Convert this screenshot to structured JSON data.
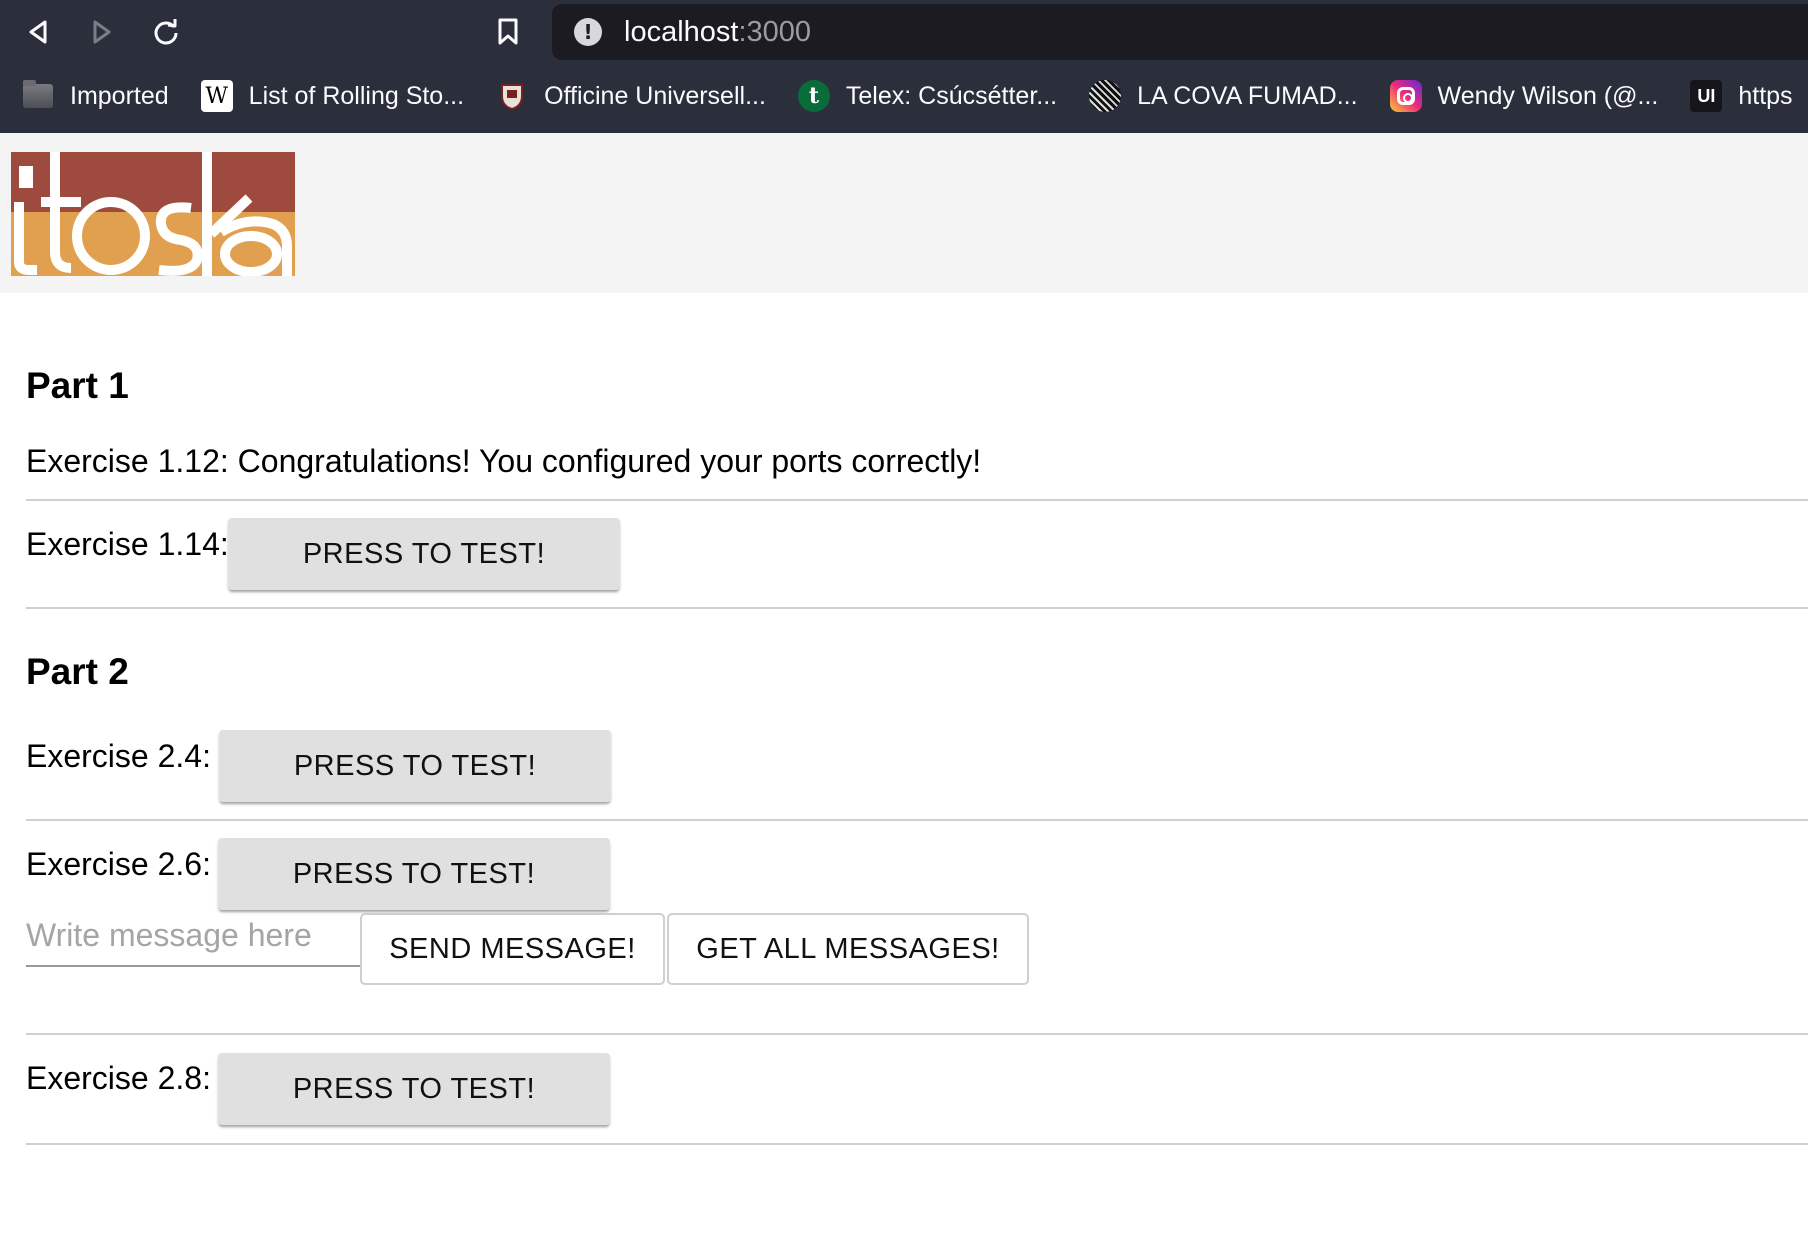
{
  "browser": {
    "url_host": "localhost",
    "url_port": ":3000",
    "bookmarks": [
      {
        "label": "Imported",
        "icon": "folder-icon"
      },
      {
        "label": "List of Rolling Sto...",
        "icon": "wikipedia-icon"
      },
      {
        "label": "Officine Universell...",
        "icon": "shield-crest-icon"
      },
      {
        "label": "Telex: Csúcsétter...",
        "icon": "telex-icon"
      },
      {
        "label": "LA COVA FUMAD...",
        "icon": "cova-icon"
      },
      {
        "label": "Wendy Wilson (@...",
        "icon": "instagram-icon"
      },
      {
        "label": "https",
        "icon": "ui-icon"
      }
    ],
    "ui_icon_text": "UI",
    "wiki_icon_text": "W",
    "telex_icon_text": "t"
  },
  "logo": {
    "text": "itoska",
    "colors": {
      "top": "#9e4a3e",
      "bottom": "#e0a050"
    }
  },
  "part1": {
    "title": "Part 1",
    "ex112_text": "Exercise 1.12: Congratulations! You configured your ports correctly!",
    "ex114_label": "Exercise 1.14:",
    "ex114_button": "PRESS TO TEST!"
  },
  "part2": {
    "title": "Part 2",
    "ex24_label": "Exercise 2.4:",
    "ex24_button": "PRESS TO TEST!",
    "ex26_label": "Exercise 2.6:",
    "ex26_button": "PRESS TO TEST!",
    "message_placeholder": "Write message here",
    "send_button": "SEND MESSAGE!",
    "get_all_button": "GET ALL MESSAGES!",
    "ex28_label": "Exercise 2.8:",
    "ex28_button": "PRESS TO TEST!"
  }
}
